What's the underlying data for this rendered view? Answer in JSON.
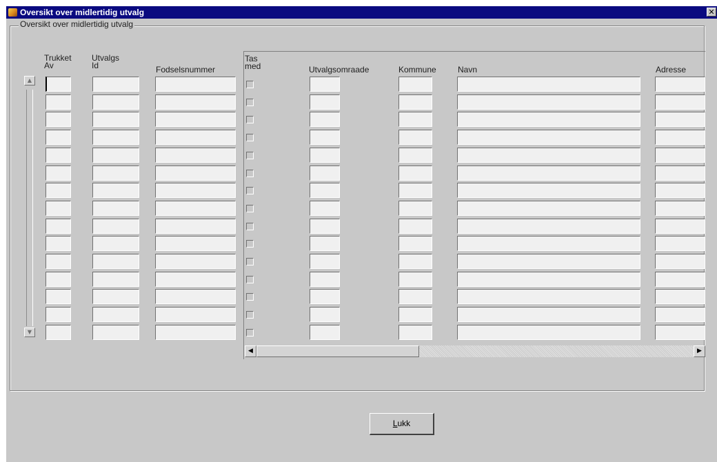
{
  "window": {
    "title": "Oversikt over midlertidig utvalg",
    "close_glyph": "✕"
  },
  "group": {
    "title": "Oversikt over midlertidig utvalg"
  },
  "columns": {
    "trukket_av": [
      "Trukket",
      "Av"
    ],
    "utvalgs_id": [
      "Utvalgs",
      "Id"
    ],
    "fodselsnummer": "Fodselsnummer",
    "tas_med": [
      "Tas",
      "med"
    ],
    "utvalgsomraade": "Utvalgsomraade",
    "kommune": "Kommune",
    "navn": "Navn",
    "adresse": "Adresse"
  },
  "rows": 15,
  "scroll": {
    "up": "▲",
    "down": "▼",
    "left": "◀",
    "right": "▶"
  },
  "buttons": {
    "lukk_underlined": "L",
    "lukk_rest": "ukk"
  }
}
